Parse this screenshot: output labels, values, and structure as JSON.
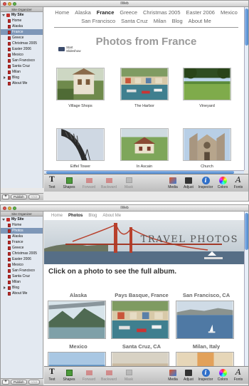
{
  "app_title": "iWeb",
  "sidebar": {
    "header": "Site Organizer",
    "site": "My Site",
    "pages_top": [
      "Home",
      "Alaska",
      "France",
      "Greece",
      "Christmas 2005",
      "Easter 2006",
      "Mexico",
      "San Francisco",
      "Santa Cruz",
      "Milan",
      "Blog",
      "About Me"
    ],
    "pages_bottom": [
      "Home",
      "Photos",
      "Alaska",
      "France",
      "Greece",
      "Christmas 2005",
      "Easter 2006",
      "Mexico",
      "San Francisco",
      "Santa Cruz",
      "Milan",
      "Blog",
      "About Me"
    ],
    "selected_top": "France",
    "selected_bottom": "Photos",
    "plus": "+",
    "publish": "Publish",
    "visit": "Visit"
  },
  "france_page": {
    "nav": [
      "Home",
      "Alaska",
      "France",
      "Greece",
      "Christmas 2005",
      "Easter 2006",
      "Mexico",
      "San Francisco",
      "Santa Cruz",
      "Milan",
      "Blog",
      "About Me"
    ],
    "current": "France",
    "title": "Photos from France",
    "slideshow": "Start Slideshow",
    "photos": [
      "Village Shops",
      "The Harbor",
      "Vineyard",
      "Eiffel Tower",
      "In Ascain",
      "Church"
    ]
  },
  "photos_page": {
    "nav": [
      "Home",
      "Photos",
      "Blog",
      "About Me"
    ],
    "current": "Photos",
    "banner_title": "TRAVEL PHOTOS",
    "prompt": "Click on a photo to see the full album.",
    "albums": [
      "Alaska",
      "Pays Basque, France",
      "San Francisco, CA",
      "Mexico",
      "Santa Cruz, CA",
      "Milan, Italy"
    ]
  },
  "toolbar": {
    "text": "Text",
    "shapes": "Shapes",
    "forward": "Forward",
    "backward": "Backward",
    "mask": "Mask",
    "media": "Media",
    "adjust": "Adjust",
    "inspector": "Inspector",
    "colors": "Colors",
    "fonts": "Fonts"
  },
  "colors": {
    "selection": "#7e97b8",
    "page_icon": "#c2302c",
    "scroll_accent": "#4a86cf"
  }
}
